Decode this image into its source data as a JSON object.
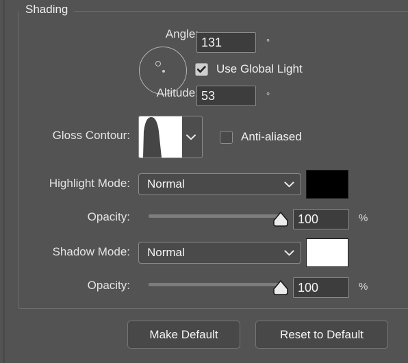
{
  "group": {
    "title": "Shading"
  },
  "angle": {
    "label": "Angle:",
    "value": "131",
    "unit": "°",
    "dial_icon": "angle-dial-icon"
  },
  "global_light": {
    "label": "Use Global Light",
    "checked": "true",
    "icon": "checkmark-icon"
  },
  "altitude": {
    "label": "Altitude:",
    "value": "53",
    "unit": "°"
  },
  "gloss_contour": {
    "label": "Gloss Contour:",
    "preview_icon": "contour-curve-preview",
    "arrow_icon": "chevron-down-icon"
  },
  "anti_aliased": {
    "label": "Anti-aliased",
    "checked": "false"
  },
  "highlight_mode": {
    "label": "Highlight Mode:",
    "value": "Normal",
    "arrow_icon": "chevron-down-icon",
    "swatch_color": "#000000",
    "swatch_name": "highlight-color-swatch"
  },
  "highlight_opacity": {
    "label": "Opacity:",
    "value": "100",
    "unit": "%",
    "percent": 100
  },
  "shadow_mode": {
    "label": "Shadow Mode:",
    "value": "Normal",
    "arrow_icon": "chevron-down-icon",
    "swatch_color": "#ffffff",
    "swatch_name": "shadow-color-swatch"
  },
  "shadow_opacity": {
    "label": "Opacity:",
    "value": "100",
    "unit": "%",
    "percent": 100
  },
  "buttons": {
    "make_default": "Make Default",
    "reset_to_default": "Reset to Default"
  },
  "colors": {
    "background": "#535353",
    "field_background": "#3d3d3d",
    "border": "#8c8c8c",
    "text": "#f0f0f0"
  }
}
